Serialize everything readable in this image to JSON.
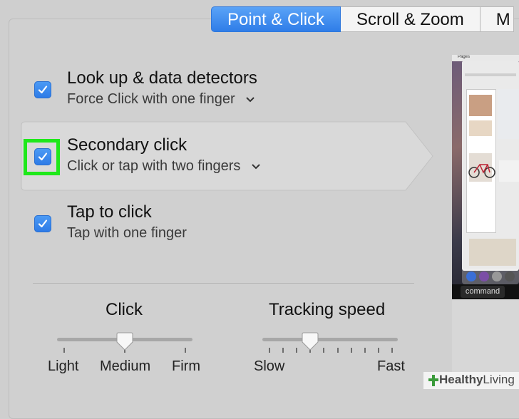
{
  "tabs": [
    {
      "label": "Point & Click",
      "active": true
    },
    {
      "label": "Scroll & Zoom",
      "active": false
    },
    {
      "label": "M",
      "active": false
    }
  ],
  "options": [
    {
      "title": "Look up & data detectors",
      "subtitle": "Force Click with one finger",
      "checked": true,
      "has_menu": true
    },
    {
      "title": "Secondary click",
      "subtitle": "Click or tap with two fingers",
      "checked": true,
      "has_menu": true,
      "highlighted": true
    },
    {
      "title": "Tap to click",
      "subtitle": "Tap with one finger",
      "checked": true,
      "has_menu": false
    }
  ],
  "sliders": {
    "click": {
      "label": "Click",
      "min_label": "Light",
      "mid_label": "Medium",
      "max_label": "Firm",
      "value_fraction": 0.5
    },
    "tracking": {
      "label": "Tracking speed",
      "min_label": "Slow",
      "max_label": "Fast",
      "value_fraction": 0.35
    }
  },
  "preview": {
    "window_title": "Pages",
    "key_label": "command"
  },
  "watermark": {
    "brand_bold": "Healthy",
    "brand_rest": "Living"
  },
  "colors": {
    "accent": "#2f7de8",
    "highlight_outline": "#1ee81a",
    "panel": "#d0d0d0"
  }
}
